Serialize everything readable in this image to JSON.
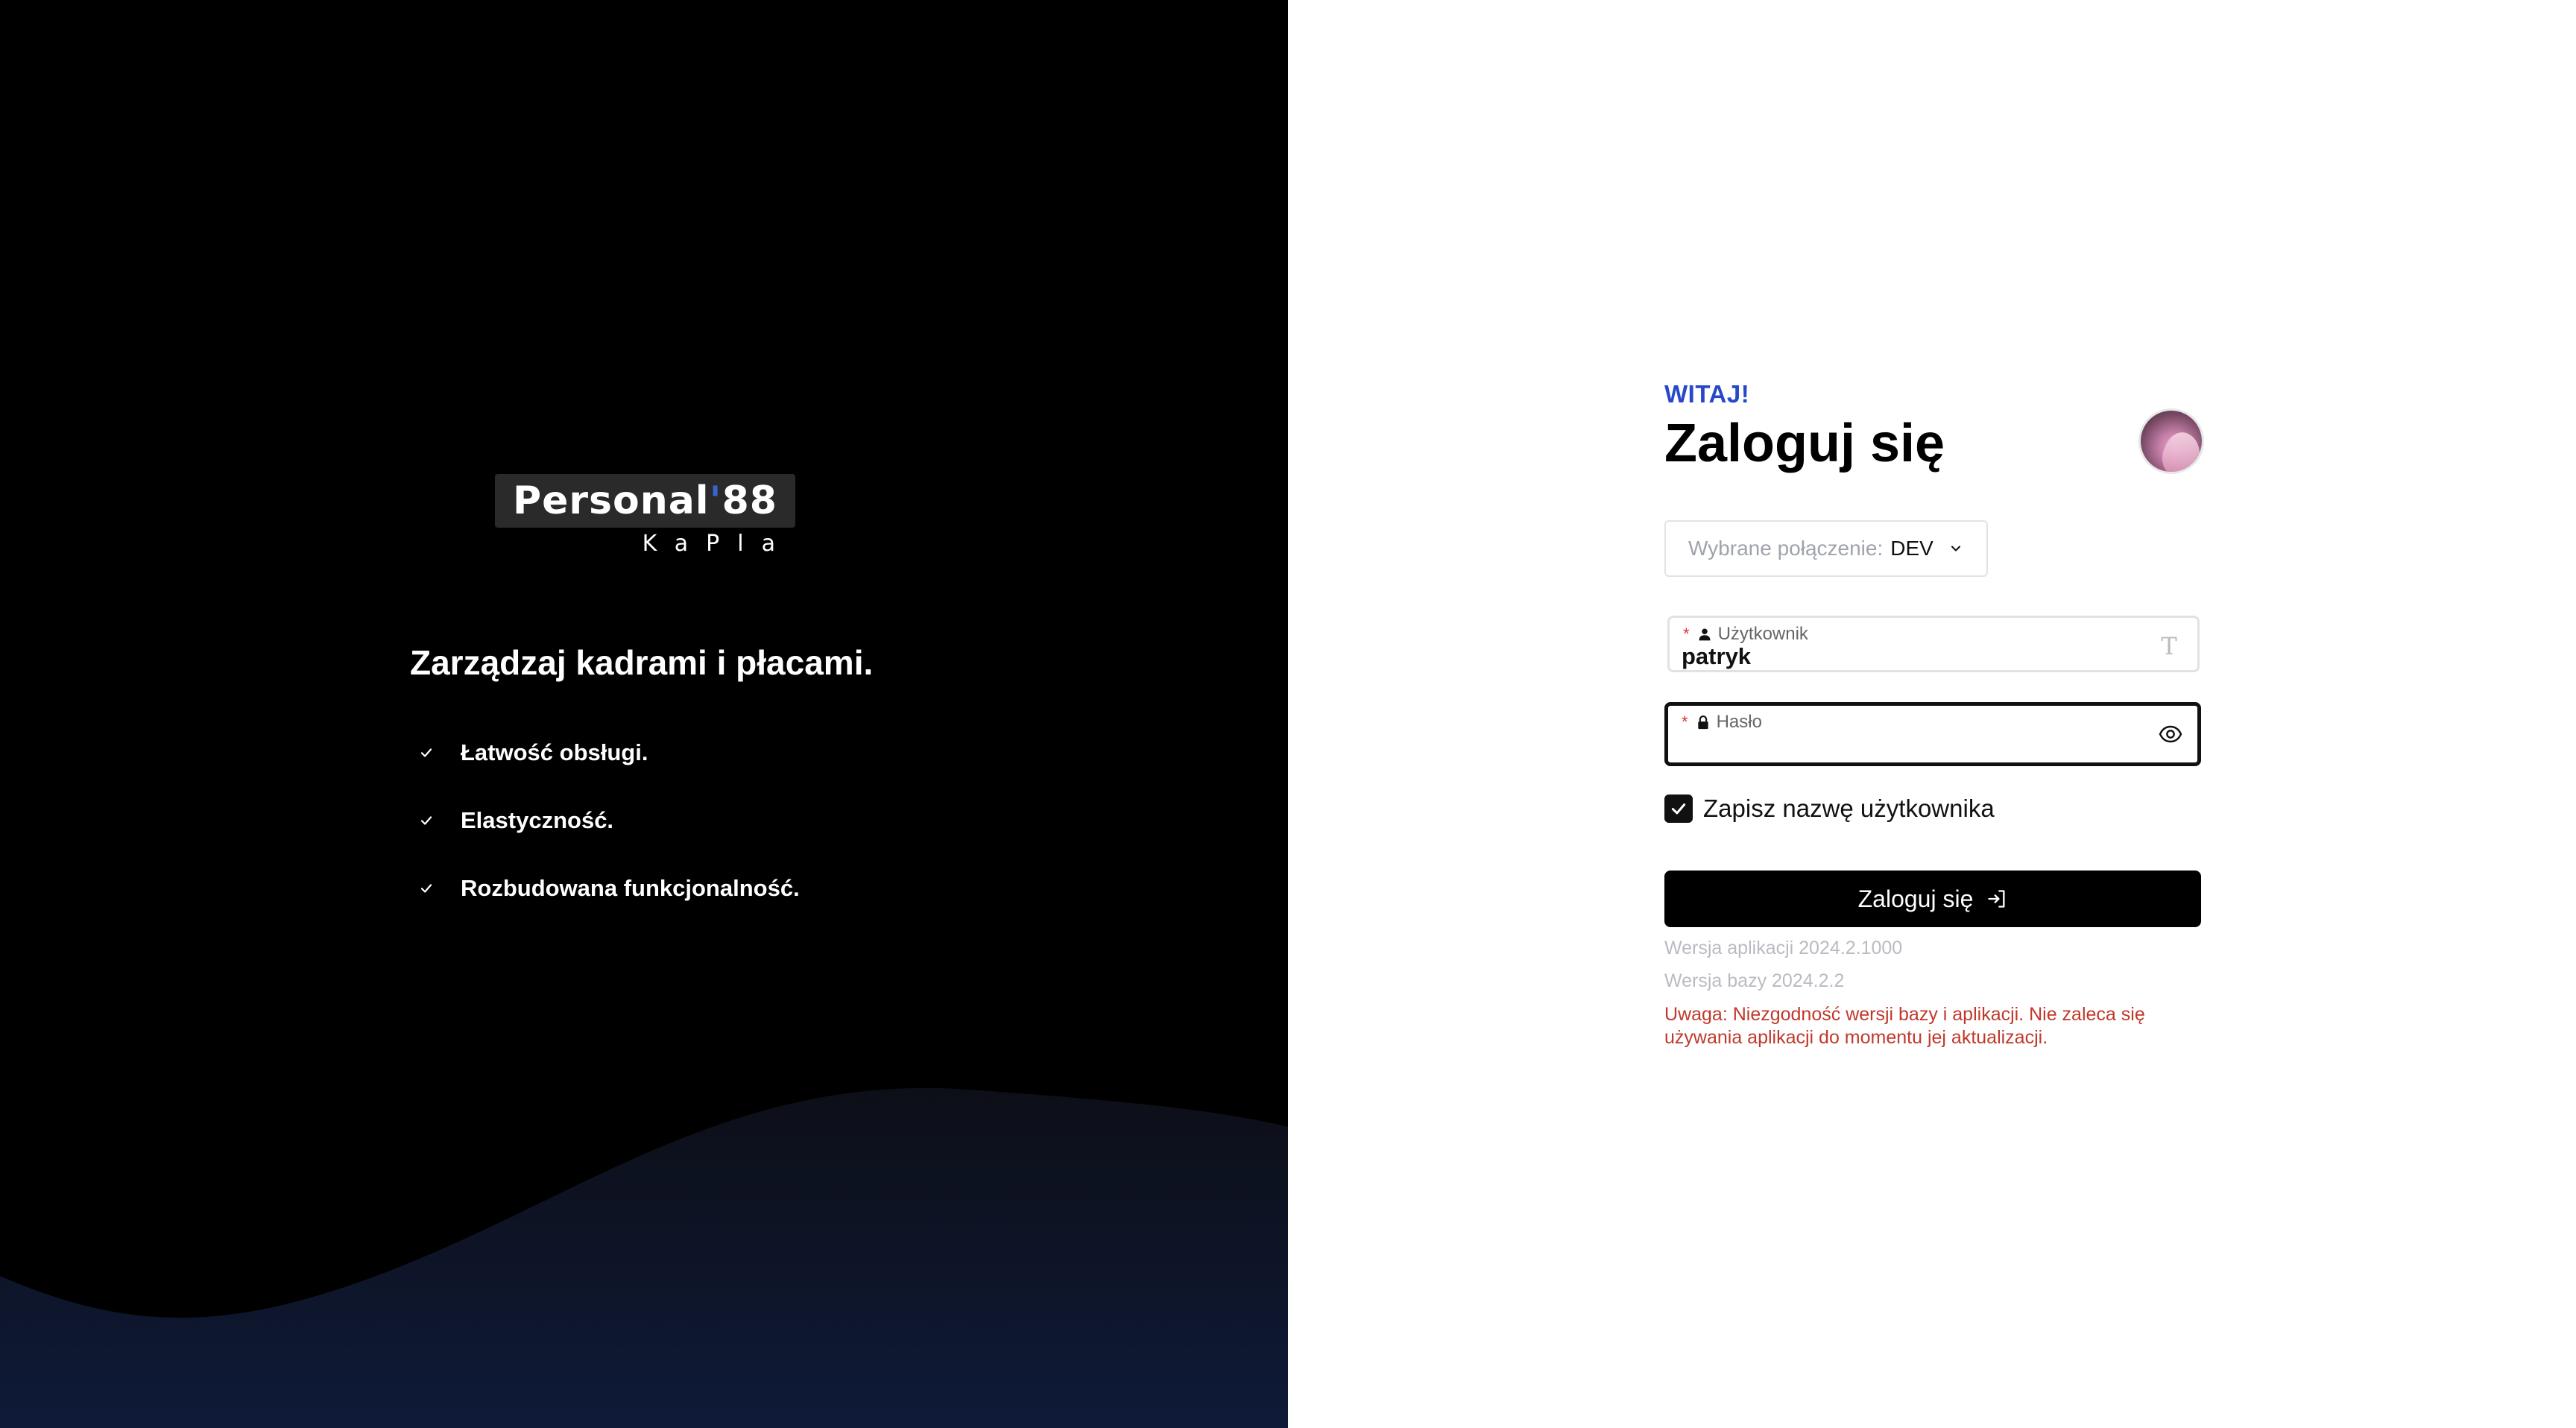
{
  "brand": {
    "logo_main": "Personal",
    "logo_accent": "'",
    "logo_num": "88",
    "logo_sub": "KaPla"
  },
  "left": {
    "headline": "Zarządzaj kadrami i płacami.",
    "features": [
      "Łatwość obsługi.",
      "Elastyczność.",
      "Rozbudowana funkcjonalność."
    ]
  },
  "login": {
    "welcome": "WITAJ!",
    "title": "Zaloguj się",
    "connection_label": "Wybrane połączenie:",
    "connection_value": "DEV",
    "username_label": "Użytkownik",
    "username_value": "patryk",
    "password_label": "Hasło",
    "password_value": "",
    "remember_label": "Zapisz nazwę użytkownika",
    "remember_checked": true,
    "submit_label": "Zaloguj się",
    "app_version": "Wersja aplikacji 2024.2.1000",
    "db_version": "Wersja bazy 2024.2.2",
    "warning": "Uwaga: Niezgodność wersji bazy i aplikacji. Nie zaleca się używania aplikacji do momentu jej aktualizacji."
  },
  "colors": {
    "accent": "#2749c9",
    "warning": "#c0392b",
    "muted": "#b9bbc2"
  },
  "icons": {
    "username_field": "person-icon",
    "password_field": "lock-icon",
    "password_toggle": "eye-icon",
    "username_end": "text-cursor-icon",
    "submit": "login-icon",
    "connection": "chevron-down-icon",
    "features": "check-icon"
  }
}
